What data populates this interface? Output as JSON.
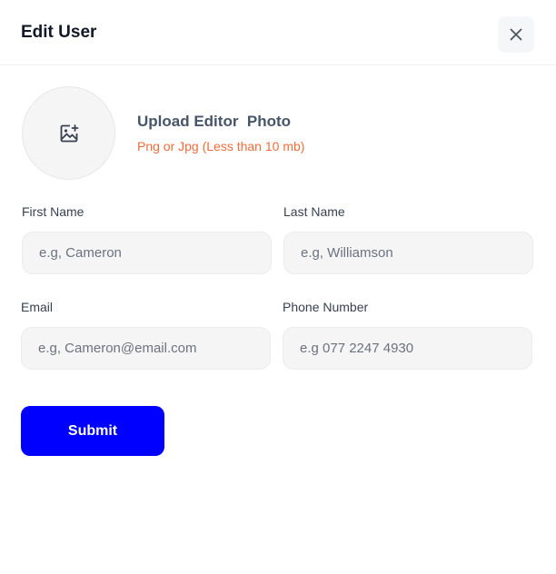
{
  "dialog": {
    "title": "Edit User",
    "close_icon": "close-icon"
  },
  "upload": {
    "icon": "image-add-icon",
    "title": "Upload Editor  Photo",
    "hint": "Png or Jpg (Less than 10 mb)"
  },
  "form": {
    "first_name": {
      "label": "First Name",
      "placeholder": "e.g, Cameron",
      "value": ""
    },
    "last_name": {
      "label": "Last Name",
      "placeholder": "e.g, Williamson",
      "value": ""
    },
    "email": {
      "label": "Email",
      "placeholder": "e.g, Cameron@email.com",
      "value": ""
    },
    "phone": {
      "label": "Phone Number",
      "placeholder": "e.g 077 2247 4930",
      "value": ""
    },
    "submit_label": "Submit"
  },
  "colors": {
    "accent": "#0000FF",
    "hint": "#F26B3A",
    "input_bg": "#F5F5F5"
  }
}
